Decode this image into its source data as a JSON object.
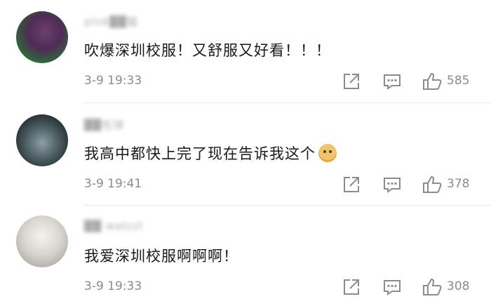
{
  "comments": [
    {
      "username": "pink██猫",
      "text": "吹爆深圳校服！又舒服又好看！！！",
      "time": "3-9 19:33",
      "likes": "585",
      "has_emoji": false
    },
    {
      "username": "██毛球",
      "text": "我高中都快上完了现在告诉我这个",
      "time": "3-9 19:41",
      "likes": "378",
      "has_emoji": true,
      "emoji": "doge-emoji"
    },
    {
      "username": "██ watzzl",
      "text": "我爱深圳校服啊啊啊！",
      "time": "3-9 19:33",
      "likes": "308",
      "has_emoji": false
    }
  ],
  "icons": {
    "share": "share-icon",
    "reply": "reply-icon",
    "like": "thumbs-up-icon"
  },
  "colors": {
    "text": "#1a1a1a",
    "meta": "#8c8c8c",
    "divider": "#ececec"
  }
}
